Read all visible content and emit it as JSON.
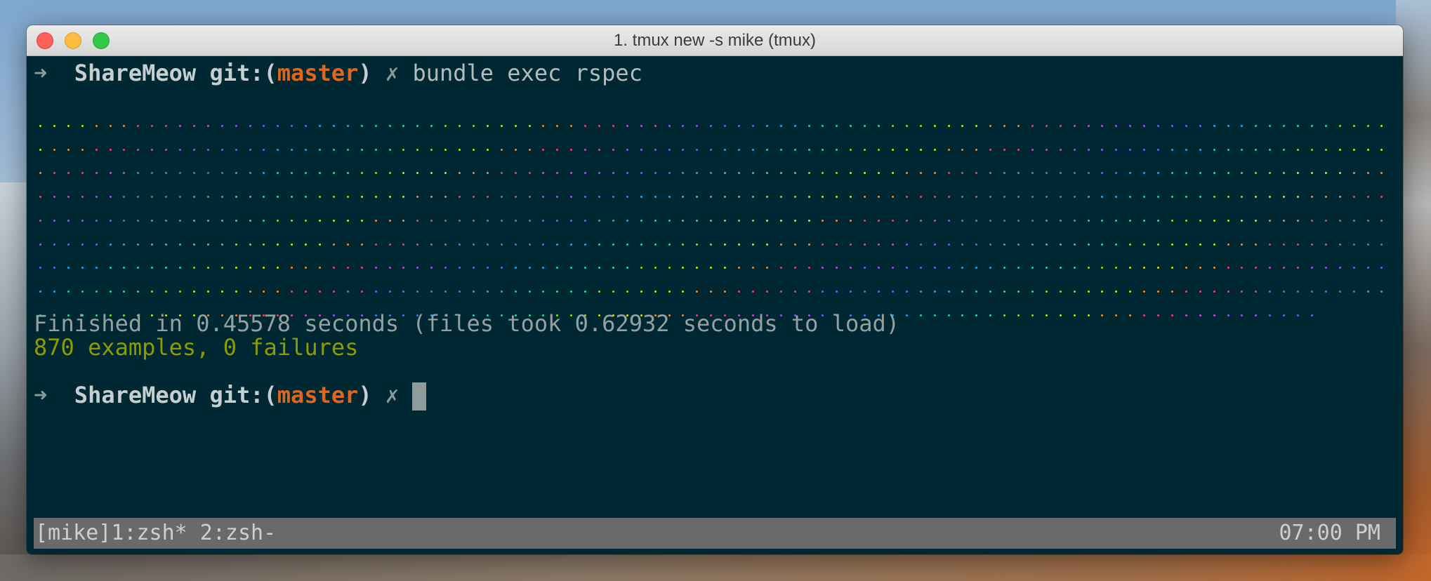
{
  "window": {
    "title": "1. tmux new -s mike (tmux)"
  },
  "prompt1": {
    "arrow": "➜",
    "dir": "ShareMeow",
    "git_prefix": "git:(",
    "branch": "master",
    "git_suffix": ")",
    "dirty": "✗",
    "command": "bundle exec rspec"
  },
  "progress": {
    "dot_char": ".",
    "row_count": 9,
    "palette": [
      "#d8e400",
      "#ff8a1f",
      "#ff3a6a",
      "#d043d4",
      "#9a4dff",
      "#3a7bff",
      "#1aa8ff",
      "#16d0d0",
      "#1ee58a",
      "#7ae61c"
    ]
  },
  "output": {
    "finished": "Finished in 0.45578 seconds (files took 0.62932 seconds to load)",
    "summary": "870 examples, 0 failures"
  },
  "prompt2": {
    "arrow": "➜",
    "dir": "ShareMeow",
    "git_prefix": "git:(",
    "branch": "master",
    "git_suffix": ")",
    "dirty": "✗"
  },
  "statusbar": {
    "left": "[mike]1:zsh* 2:zsh-",
    "right": "07:00 PM"
  }
}
